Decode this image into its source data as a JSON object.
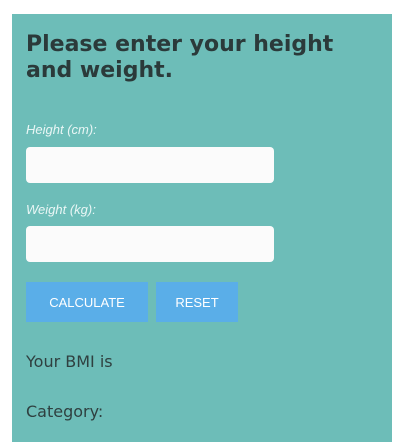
{
  "form": {
    "heading": "Please enter your height and weight.",
    "height_label": "Height (cm):",
    "height_value": "",
    "weight_label": "Weight (kg):",
    "weight_value": "",
    "calculate_label": "CALCULATE",
    "reset_label": "RESET"
  },
  "results": {
    "bmi_text": "Your BMI is",
    "category_text": "Category:"
  },
  "colors": {
    "panel_background": "#6dbdb8",
    "button_background": "#5aaee8",
    "heading_text": "#2b3a3a"
  }
}
